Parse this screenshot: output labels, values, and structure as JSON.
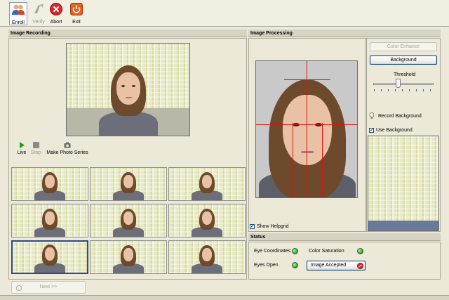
{
  "toolbar": {
    "enroll": "Enroll",
    "verify": "Verify",
    "abort": "Abort",
    "exit": "Exit"
  },
  "recording": {
    "title": "Image Recording",
    "live": "Live",
    "stop": "Stop",
    "series": "Make Photo Series"
  },
  "processing": {
    "title": "Image Processing",
    "color_enhance": "Color Enhance",
    "background": "Background",
    "threshold": "Threshold",
    "threshold_level": 0.4,
    "record_background": "Record Background",
    "use_background": "Use Background",
    "use_background_checked": true,
    "show_helpgrid": "Show Helpgrid",
    "show_helpgrid_checked": true
  },
  "status": {
    "title": "Status",
    "eye_coordinates": "Eye Coordinates:",
    "color_saturation": "Color Saturation",
    "eyes_open": "Eyes Open",
    "image_accepted": "Image Accepted"
  },
  "footer": {
    "next": "Next >>"
  },
  "colors": {
    "ok": "#2f9a2a",
    "error": "#d9262a",
    "guide": "#e01010",
    "selection": "#2e4a8a"
  },
  "icons": {
    "enroll": "users-icon",
    "verify": "verify-icon",
    "abort": "abort-icon",
    "exit": "power-icon",
    "live": "play-icon",
    "stop": "stop-icon",
    "series": "camera-icon",
    "record_background": "light-bulb-icon"
  }
}
